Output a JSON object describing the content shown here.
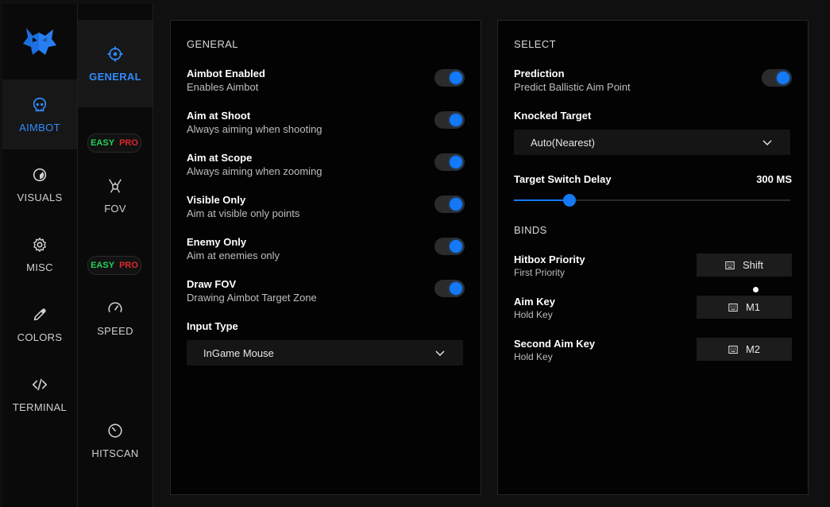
{
  "colors": {
    "accent": "#2f8bff",
    "toggle_on": "#1479f5",
    "easy": "#24d15a",
    "pro": "#e0262a"
  },
  "nav": {
    "logo_icon": "wolf-logo-icon",
    "items": [
      {
        "label": "AIMBOT",
        "icon": "skull-icon",
        "active": true
      },
      {
        "label": "VISUALS",
        "icon": "eye-icon"
      },
      {
        "label": "MISC",
        "icon": "gear-icon"
      },
      {
        "label": "COLORS",
        "icon": "eyedropper-icon"
      },
      {
        "label": "TERMINAL",
        "icon": "code-icon"
      }
    ]
  },
  "subnav": {
    "items": [
      {
        "label": "GENERAL",
        "icon": "crosshair-icon",
        "active": true
      },
      {
        "label": "FOV",
        "icon": "fov-icon"
      },
      {
        "label": "SPEED",
        "icon": "speedometer-icon"
      },
      {
        "label": "HITSCAN",
        "icon": "timer-icon"
      }
    ],
    "badges": [
      {
        "easy": "EASY",
        "pro": "PRO"
      },
      {
        "easy": "EASY",
        "pro": "PRO"
      }
    ]
  },
  "general": {
    "title": "GENERAL",
    "toggles": [
      {
        "title": "Aimbot Enabled",
        "subtitle": "Enables Aimbot",
        "on": true
      },
      {
        "title": "Aim at Shoot",
        "subtitle": "Always aiming when shooting",
        "on": true
      },
      {
        "title": "Aim at Scope",
        "subtitle": "Always aiming when zooming",
        "on": true
      },
      {
        "title": "Visible Only",
        "subtitle": "Aim at visible only points",
        "on": true
      },
      {
        "title": "Enemy Only",
        "subtitle": "Aim at enemies only",
        "on": true
      },
      {
        "title": "Draw FOV",
        "subtitle": "Drawing Aimbot Target Zone",
        "on": true
      }
    ],
    "input_type_label": "Input Type",
    "input_type_value": "InGame Mouse"
  },
  "select": {
    "title": "SELECT",
    "prediction": {
      "title": "Prediction",
      "subtitle": "Predict Ballistic Aim Point",
      "on": true
    },
    "knocked_label": "Knocked Target",
    "knocked_value": "Auto(Nearest)",
    "switch_delay_label": "Target Switch Delay",
    "switch_delay_value": "300 MS",
    "switch_delay_fraction": 0.2
  },
  "binds": {
    "title": "BINDS",
    "items": [
      {
        "title": "Hitbox Priority",
        "subtitle": "First Priority",
        "key": "Shift",
        "key_icon": "keyboard-icon"
      },
      {
        "title": "Aim Key",
        "subtitle": "Hold Key",
        "key": "M1",
        "key_icon": "keyboard-icon"
      },
      {
        "title": "Second Aim Key",
        "subtitle": "Hold Key",
        "key": "M2",
        "key_icon": "keyboard-icon"
      }
    ]
  }
}
